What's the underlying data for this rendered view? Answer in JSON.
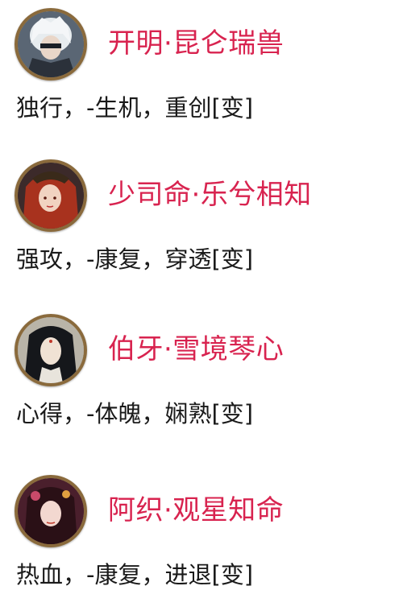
{
  "heroes": [
    {
      "name": "开明·昆仑瑞兽",
      "traits": "独行，-生机，重创[变]",
      "avatar_icon": "white-haired-warrior-portrait"
    },
    {
      "name": "少司命·乐兮相知",
      "traits": "强攻，-康复，穿透[变]",
      "avatar_icon": "red-haired-woman-portrait"
    },
    {
      "name": "伯牙·雪境琴心",
      "traits": "心得，-体魄，娴熟[变]",
      "avatar_icon": "black-haired-scholar-portrait"
    },
    {
      "name": "阿织·观星知命",
      "traits": "热血，-康复，进退[变]",
      "avatar_icon": "dark-haired-woman-portrait"
    }
  ],
  "colors": {
    "name": "#d8234f",
    "text": "#1a1a1a",
    "frame": "#8a6a3c"
  }
}
